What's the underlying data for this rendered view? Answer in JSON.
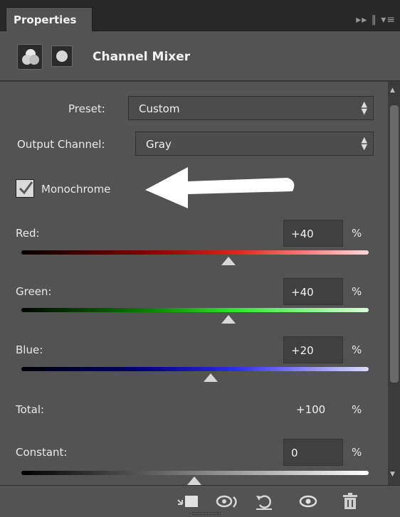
{
  "panel": {
    "tab_label": "Properties",
    "tab_controls": "▸▸ ‖ ▾≡"
  },
  "header": {
    "title": "Channel Mixer",
    "adjustment_icon": "rgb-circles-icon",
    "mask_icon": "layer-mask-icon"
  },
  "preset": {
    "label": "Preset:",
    "value": "Custom"
  },
  "output_channel": {
    "label": "Output Channel:",
    "value": "Gray"
  },
  "monochrome": {
    "label": "Monochrome",
    "checked": true
  },
  "red": {
    "label": "Red:",
    "value": "+40",
    "unit": "%",
    "level": 0.7
  },
  "green": {
    "label": "Green:",
    "value": "+40",
    "unit": "%",
    "level": 0.7
  },
  "blue": {
    "label": "Blue:",
    "value": "+20",
    "unit": "%",
    "level": 0.6
  },
  "total": {
    "label": "Total:",
    "value": "+100",
    "unit": "%"
  },
  "constant": {
    "label": "Constant:",
    "value": "0",
    "unit": "%",
    "level": 0.5
  },
  "footer": {
    "icons": [
      "clip-to-layer-icon",
      "view-previous-state-icon",
      "reset-icon",
      "visibility-eye-icon",
      "trash-icon"
    ]
  },
  "colors": {
    "panel_bg": "#535353",
    "tab_bar_bg": "#282828",
    "arrow": "#ffffff"
  }
}
